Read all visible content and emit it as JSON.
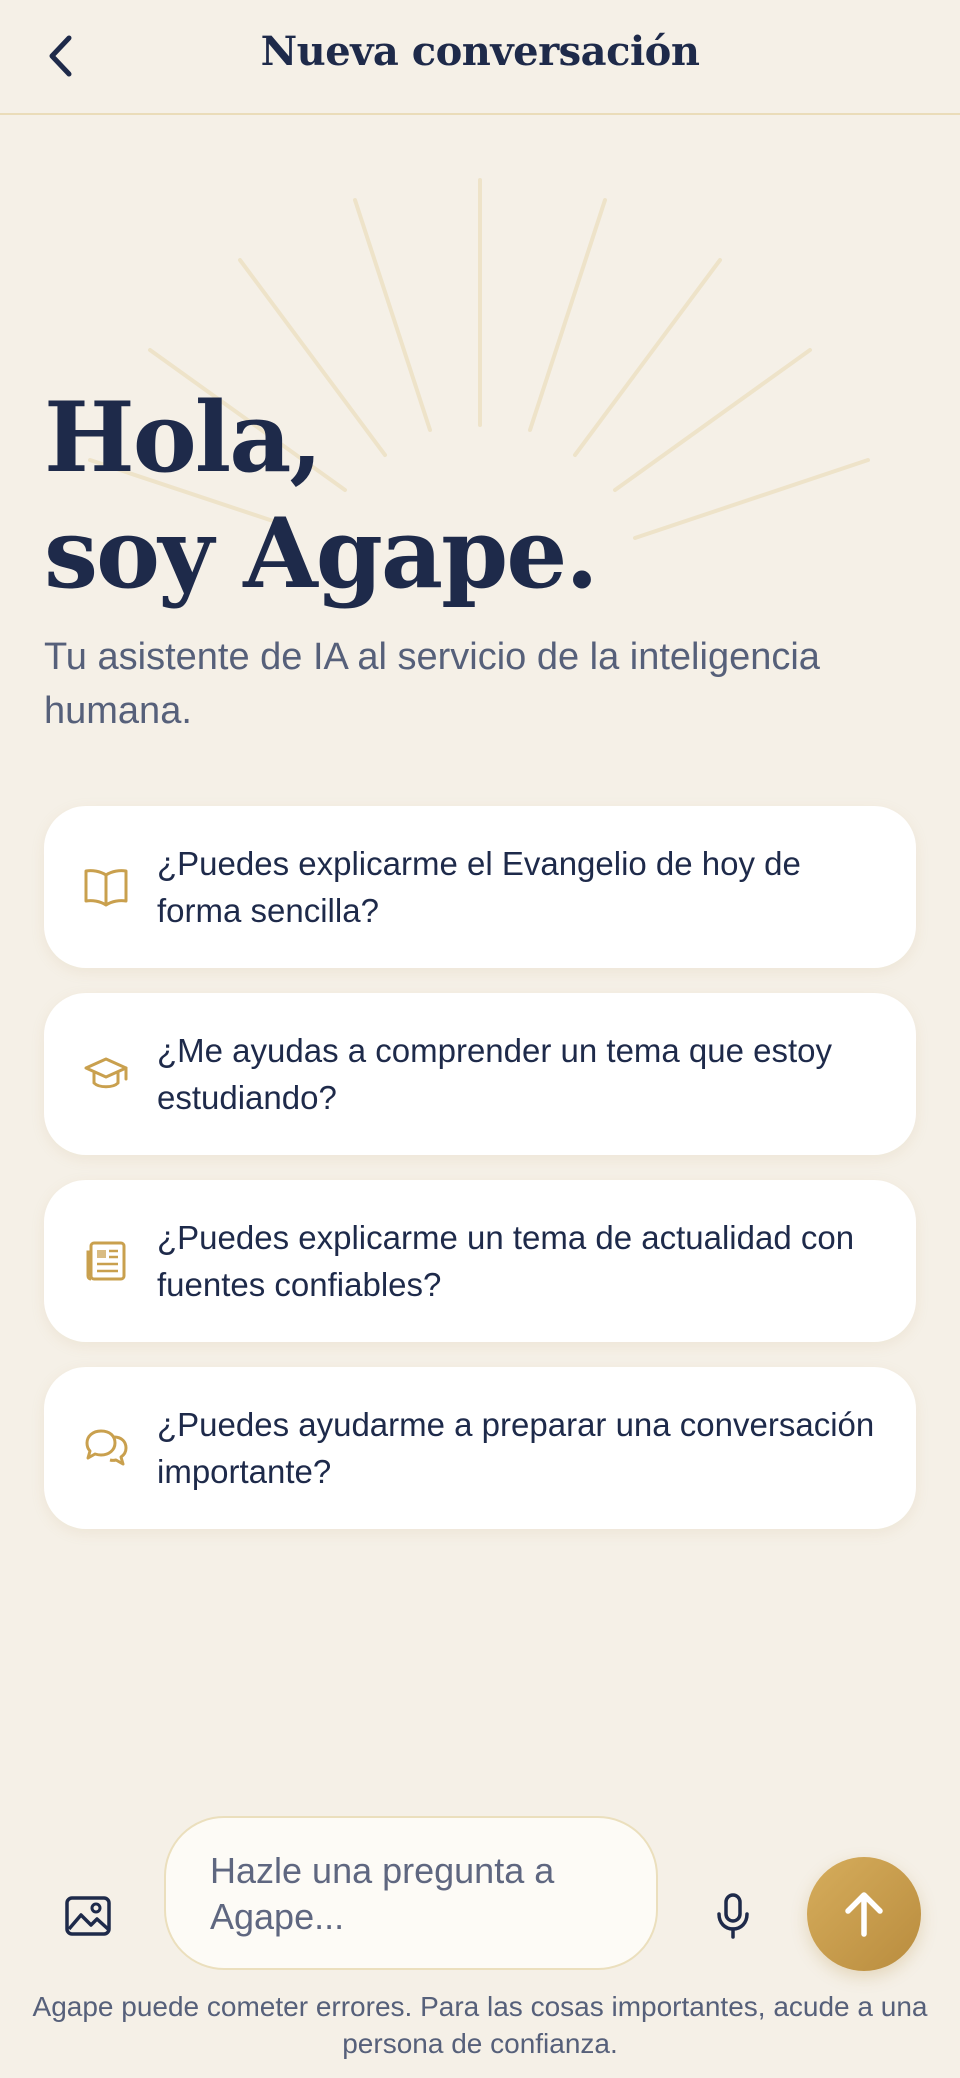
{
  "header": {
    "title": "Nueva conversación",
    "back_icon": "chevron-left-icon"
  },
  "hero": {
    "title_line1": "Hola,",
    "title_line2": "soy Agape.",
    "subtitle": "Tu asistente de IA al servicio de la inteligencia humana."
  },
  "suggestions": [
    {
      "icon": "book-open-icon",
      "text": "¿Puedes explicarme el Evangelio de hoy de forma sencilla?"
    },
    {
      "icon": "graduation-cap-icon",
      "text": "¿Me ayudas a comprender un tema que estoy estudiando?"
    },
    {
      "icon": "newspaper-icon",
      "text": "¿Puedes explicarme un tema de actualidad con fuentes confiables?"
    },
    {
      "icon": "chat-bubbles-icon",
      "text": "¿Puedes ayudarme a preparar una conversación importante?"
    }
  ],
  "composer": {
    "placeholder": "Hazle una pregunta a Agape...",
    "value": "",
    "image_icon": "image-icon",
    "mic_icon": "microphone-icon",
    "send_icon": "arrow-up-icon"
  },
  "disclaimer": "Agape puede cometer errores. Para las cosas importantes, acude a una persona de confianza.",
  "colors": {
    "background": "#f5f0e7",
    "navy": "#1e2a4a",
    "gold": "#c9a04e",
    "card": "#ffffff"
  }
}
